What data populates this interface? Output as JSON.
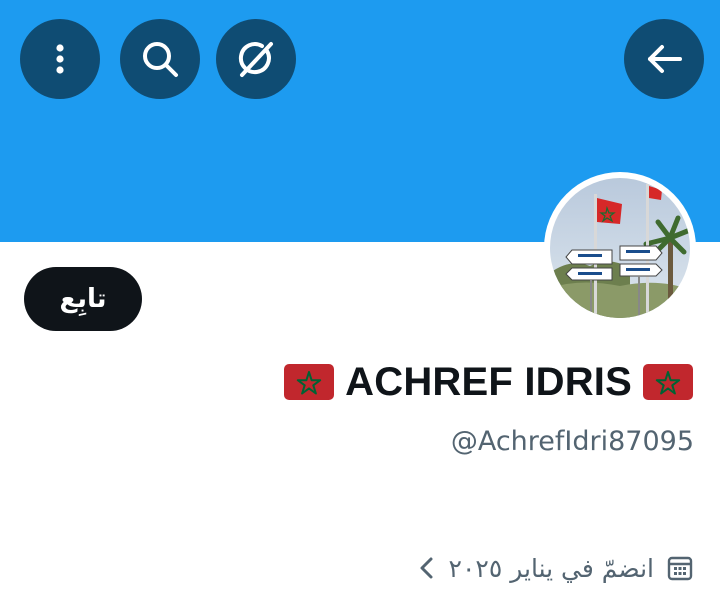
{
  "header": {
    "more_icon": "vertical-dots-icon",
    "search_icon": "search-icon",
    "grok_icon": "grok-icon",
    "back_icon": "arrow-left-icon"
  },
  "profile": {
    "follow_label": "تابِع",
    "name": "ACHREF IDRIS",
    "handle": "@AchrefIdri87095",
    "joined": "انضمّ في يناير ٢٠٢٥",
    "joined_icon": "calendar-icon",
    "chevron_icon": "chevron-left-icon"
  },
  "colors": {
    "banner": "#1d9bf0",
    "button_bg": "#0f4c73",
    "follow_bg": "#0f1419",
    "secondary_text": "#536471"
  }
}
